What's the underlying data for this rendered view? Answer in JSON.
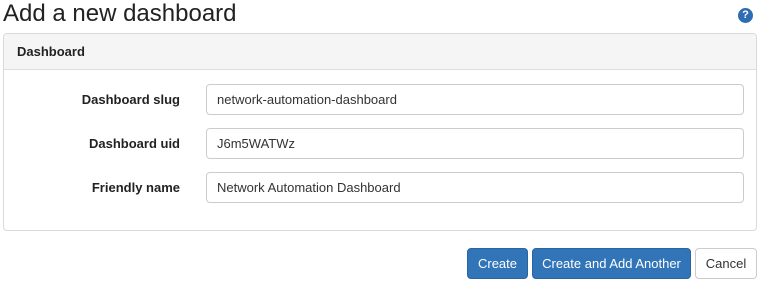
{
  "page": {
    "title": "Add a new dashboard",
    "help_glyph": "?"
  },
  "panel": {
    "heading": "Dashboard",
    "fields": [
      {
        "label": "Dashboard slug",
        "value": "network-automation-dashboard"
      },
      {
        "label": "Dashboard uid",
        "value": "J6m5WATWz"
      },
      {
        "label": "Friendly name",
        "value": "Network Automation Dashboard"
      }
    ]
  },
  "actions": {
    "create": "Create",
    "create_another": "Create and Add Another",
    "cancel": "Cancel"
  },
  "colors": {
    "primary": "#3174b8",
    "help_icon": "#2f6db3"
  },
  "icons": {
    "help": "question-circle-icon"
  }
}
